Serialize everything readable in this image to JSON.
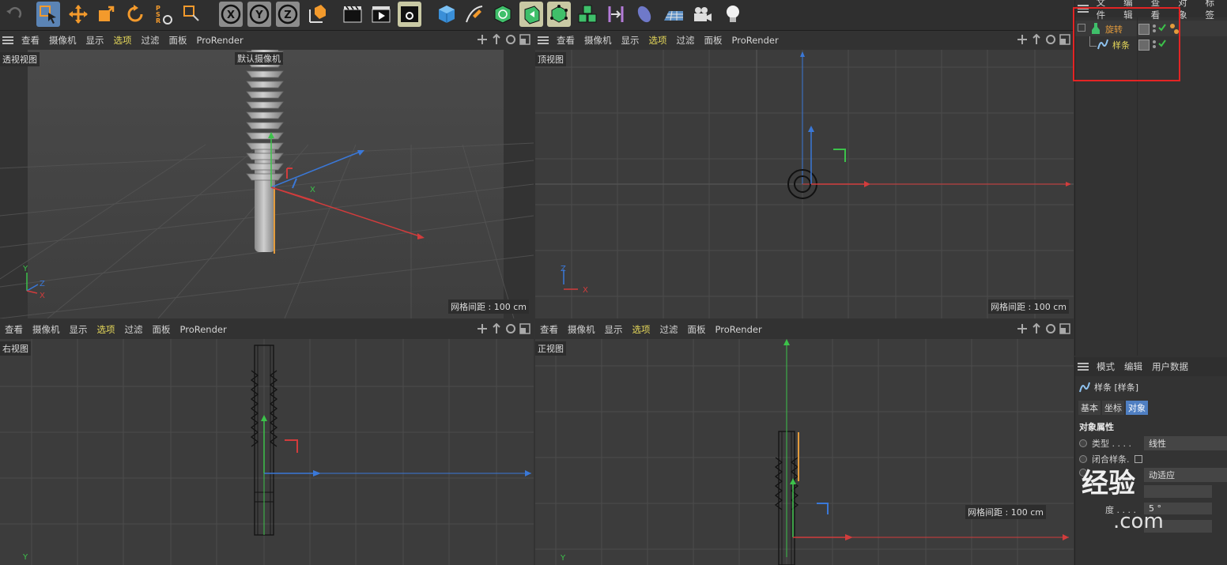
{
  "viewport_menu": [
    "查看",
    "摄像机",
    "显示",
    "选项",
    "过滤",
    "面板",
    "ProRender"
  ],
  "viewports": {
    "perspective": {
      "label": "透视视图",
      "camera": "默认摄像机",
      "grid_text": "网格间距 : 100 cm"
    },
    "top": {
      "label": "顶视图",
      "grid_text": "网格间距 : 100 cm"
    },
    "right": {
      "label": "右视图"
    },
    "front": {
      "label": "正视图",
      "grid_text": "网格间距 : 100 cm"
    }
  },
  "axis_labels": {
    "x": "X",
    "y": "Y",
    "z": "Z"
  },
  "toolbar_axis": {
    "x": "X",
    "y": "Y",
    "z": "Z"
  },
  "object_manager": {
    "menu": [
      "文件",
      "编辑",
      "查看",
      "对象",
      "标签"
    ],
    "objects": [
      {
        "name": "旋转",
        "type": "lathe"
      },
      {
        "name": "样条",
        "type": "spline"
      }
    ]
  },
  "attribute_manager": {
    "menu": [
      "模式",
      "编辑",
      "用户数据"
    ],
    "object_title": "样条 [样条]",
    "tabs": [
      "基本",
      "坐标",
      "对象"
    ],
    "active_tab": "对象",
    "section": "对象属性",
    "type_label": "类型 . . . .",
    "type_value": "线性",
    "closed_label": "闭合样条.",
    "interp_value": "动适应",
    "angle_label": "度 . . . .",
    "angle_value": "5 °"
  },
  "watermark": {
    "text": "经验",
    "domain": ".com"
  },
  "colors": {
    "accent_active": "#e6d85a",
    "object_name": "#e39b3c",
    "highlight_box": "#e32424",
    "x_axis": "#d23c3c",
    "y_axis": "#3cc24a",
    "z_axis": "#3a78d8"
  }
}
